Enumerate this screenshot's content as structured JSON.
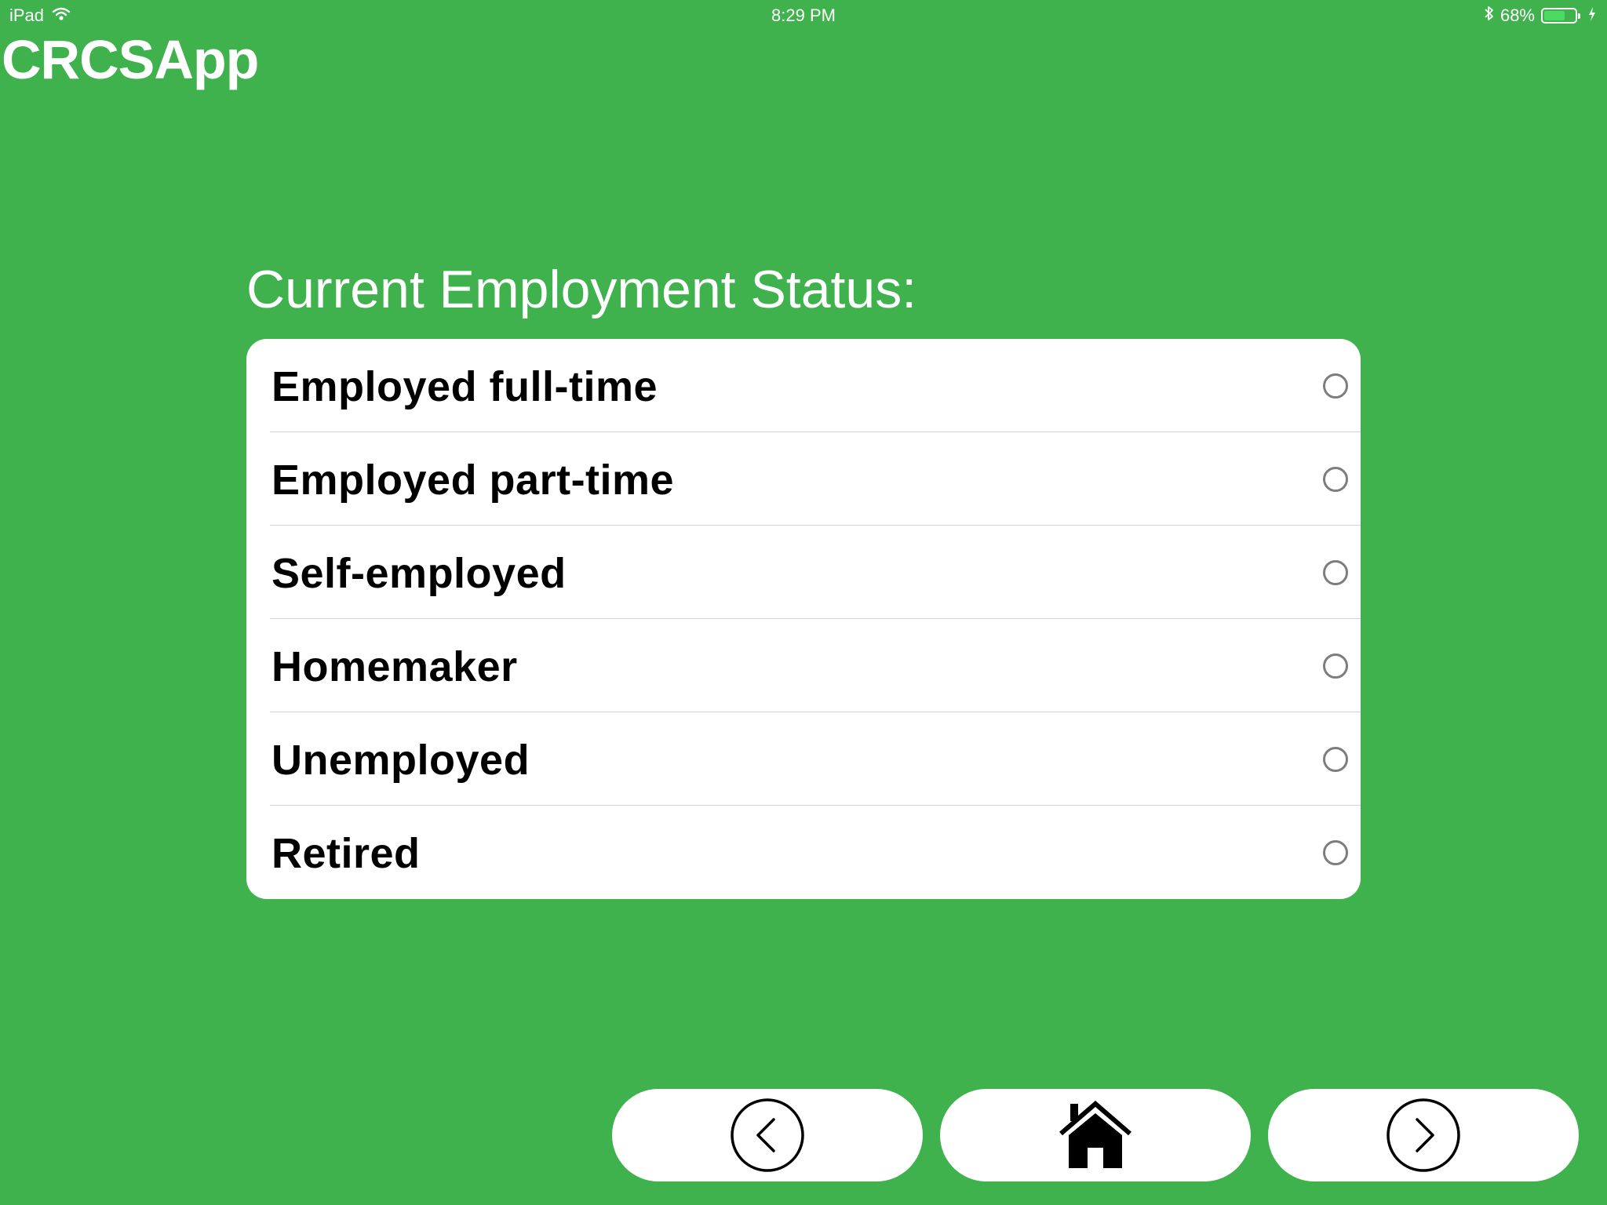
{
  "status_bar": {
    "device": "iPad",
    "time": "8:29 PM",
    "battery_percent": "68%",
    "battery_level": 0.68,
    "icons": [
      "wifi-icon",
      "bluetooth-icon",
      "battery-icon",
      "charging-icon"
    ]
  },
  "app": {
    "title": "CRCSApp"
  },
  "question": {
    "label": "Current Employment Status:"
  },
  "options": [
    {
      "label": "Employed full-time",
      "selected": false
    },
    {
      "label": "Employed part-time",
      "selected": false
    },
    {
      "label": "Self-employed",
      "selected": false
    },
    {
      "label": "Homemaker",
      "selected": false
    },
    {
      "label": "Unemployed",
      "selected": false
    },
    {
      "label": "Retired",
      "selected": false
    }
  ],
  "navigation": {
    "buttons": [
      "back-icon",
      "home-icon",
      "forward-icon"
    ]
  },
  "colors": {
    "background": "#3fb14d",
    "card": "#ffffff",
    "radio_border": "#7d7d7d",
    "battery_fill": "#4cd964"
  }
}
